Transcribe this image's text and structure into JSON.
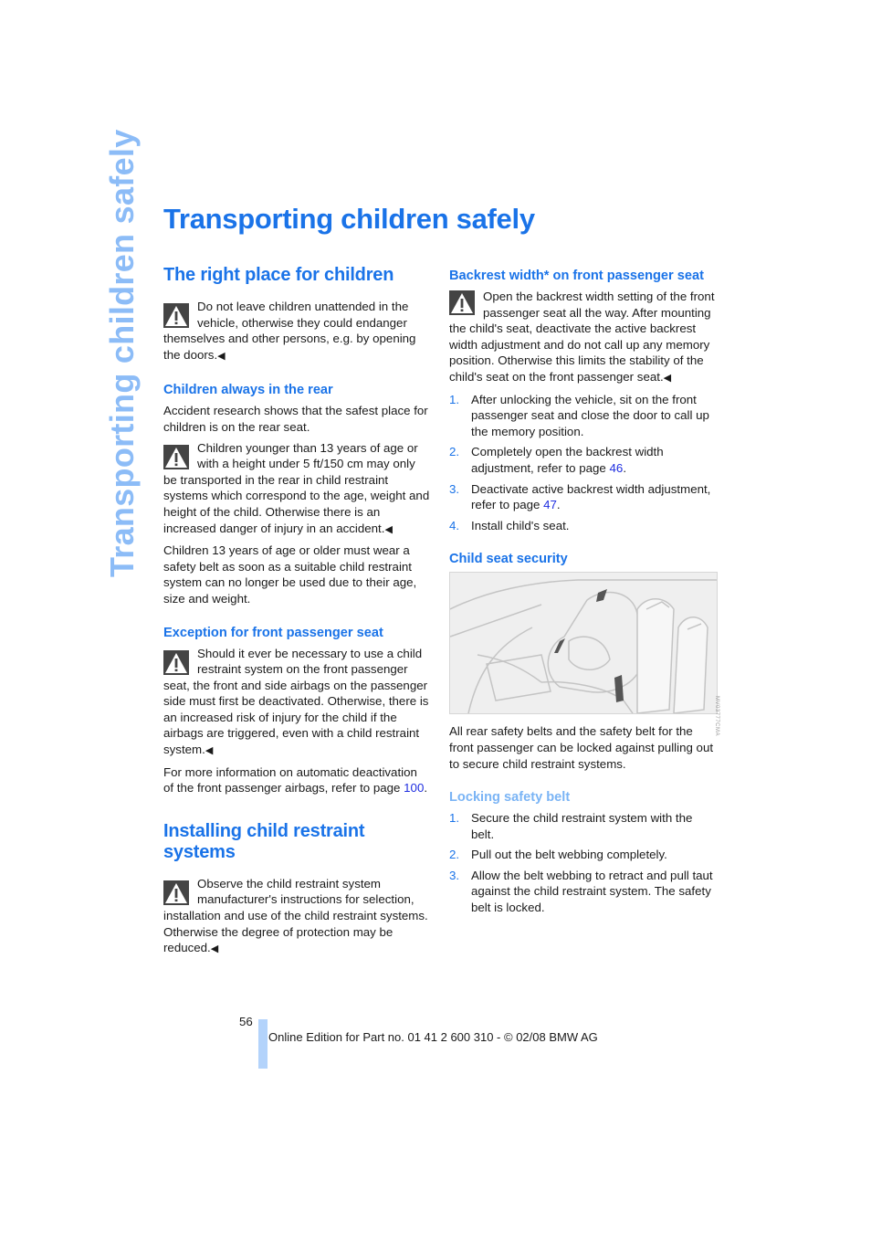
{
  "side_title": "Transporting children safely",
  "page_title": "Transporting children safely",
  "left_column": {
    "section1": {
      "heading": "The right place for children",
      "warning": "Do not leave children unattended in the vehicle, otherwise they could endanger themselves and other persons, e.g. by opening the doors."
    },
    "sub1": {
      "heading": "Children always in the rear",
      "text": "Accident research shows that the safest place for children is on the rear seat.",
      "warning": "Children younger than 13 years of age or with a height under 5 ft/150 cm may only be transported in the rear in child restraint systems which correspond to the age, weight and height of the child. Otherwise there is an increased danger of injury in an accident.",
      "text2": "Children 13 years of age or older must wear a safety belt as soon as a suitable child restraint system can no longer be used due to their age, size and weight."
    },
    "sub2": {
      "heading": "Exception for front passenger seat",
      "warning": "Should it ever be necessary to use a child restraint system on the front passenger seat, the front and side airbags on the passenger side must first be deactivated. Otherwise, there is an increased risk of injury for the child if the airbags are triggered, even with a child restraint system.",
      "text_before_link": "For more information on automatic deactivation of the front passenger airbags, refer to page ",
      "link": "100",
      "text_after_link": "."
    },
    "section2": {
      "heading": "Installing child restraint systems",
      "warning": "Observe the child restraint system manufacturer's instructions for selection, installation and use of the child restraint systems. Otherwise the degree of protection may be reduced."
    }
  },
  "right_column": {
    "sub1": {
      "heading": "Backrest width* on front passenger seat",
      "warning": "Open the backrest width setting of the front passenger seat all the way. After mounting the child's seat, deactivate the active backrest width adjustment and do not call up any memory position. Otherwise this limits the stability of the child's seat on the front passenger seat.",
      "steps": [
        {
          "num": "1.",
          "text": "After unlocking the vehicle, sit on the front passenger seat and close the door to call up the memory position.",
          "link": "",
          "after": ""
        },
        {
          "num": "2.",
          "text": "Completely open the backrest width adjustment, refer to page ",
          "link": "46",
          "after": "."
        },
        {
          "num": "3.",
          "text": "Deactivate active backrest width adjustment, refer to page ",
          "link": "47",
          "after": "."
        },
        {
          "num": "4.",
          "text": "Install child's seat.",
          "link": "",
          "after": ""
        }
      ]
    },
    "sub2": {
      "heading": "Child seat security",
      "figure_alt": "Child seat installed on rear seat, secured with safety belt",
      "figure_code": "MV03777CMA",
      "text": "All rear safety belts and the safety belt for the front passenger can be locked against pulling out to secure child restraint systems."
    },
    "sub3": {
      "heading": "Locking safety belt",
      "steps": [
        {
          "num": "1.",
          "text": "Secure the child restraint system with the belt."
        },
        {
          "num": "2.",
          "text": "Pull out the belt webbing completely."
        },
        {
          "num": "3.",
          "text": "Allow the belt webbing to retract and pull taut against the child restraint system. The safety belt is locked."
        }
      ]
    }
  },
  "end_mark": "◀",
  "footer": {
    "page_number": "56",
    "text": "Online Edition for Part no. 01 41 2 600 310 - © 02/08 BMW AG"
  },
  "colors": {
    "heading_blue": "#1a73e8",
    "side_title_blue": "#8cbcf7",
    "link_blue": "#1f2ee0",
    "footer_bar": "#b3d3fb"
  }
}
